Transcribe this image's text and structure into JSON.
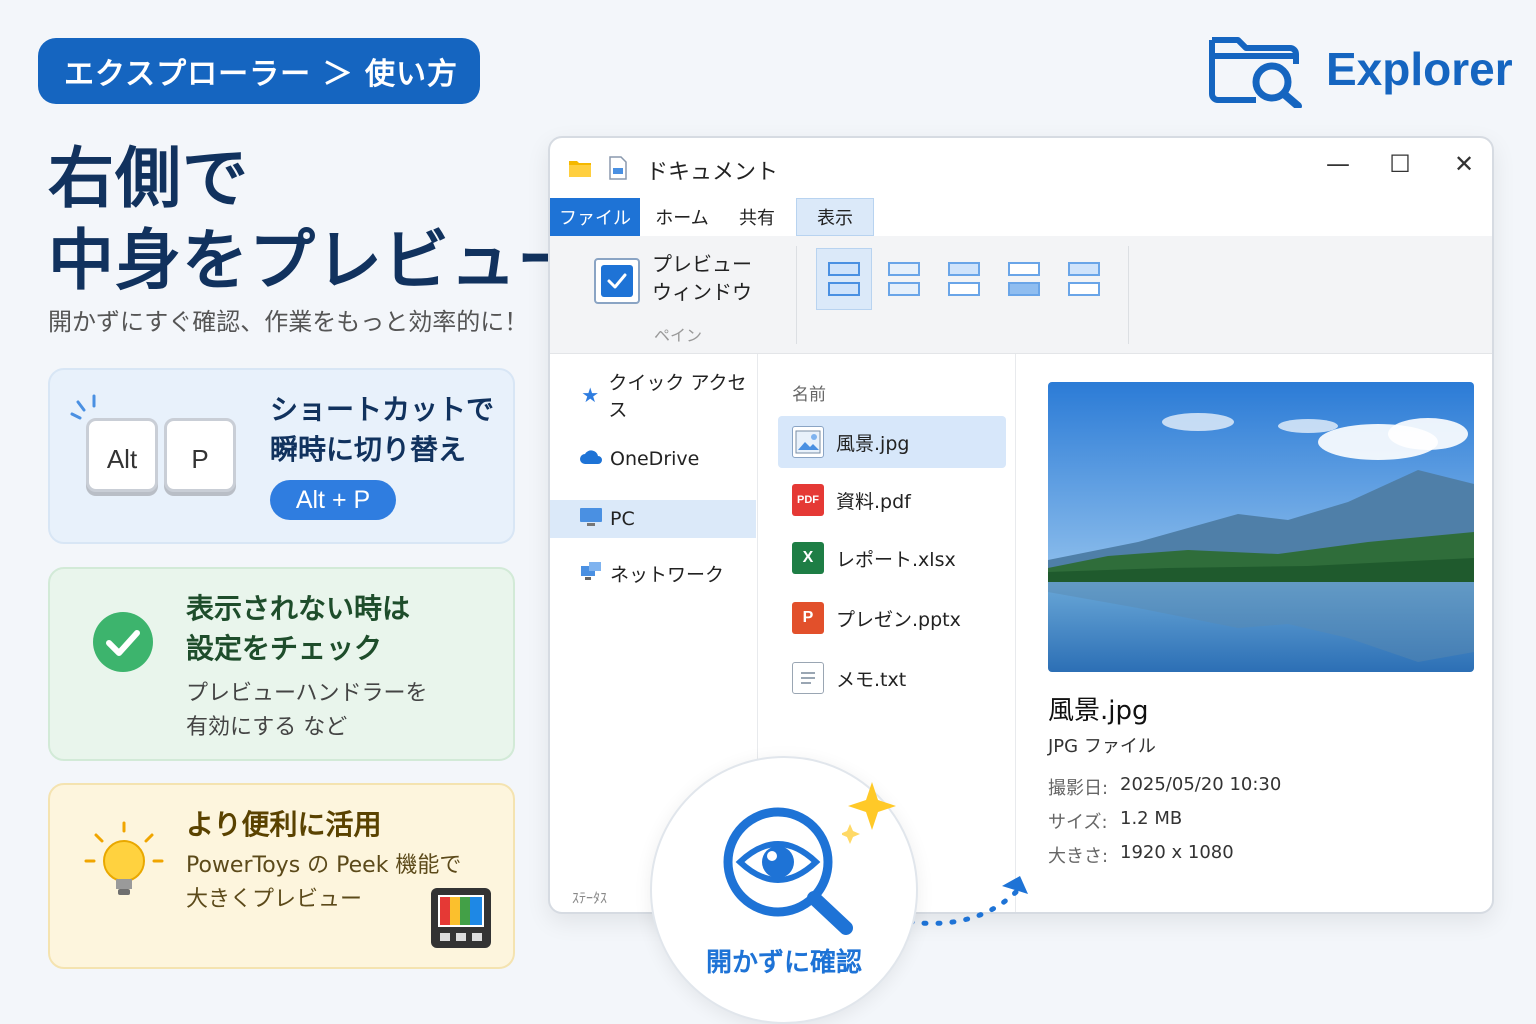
{
  "breadcrumb": "エクスプローラー ＞ 使い方",
  "brand": {
    "name": "Explorer",
    "accent": "#1565c0"
  },
  "headline": {
    "line1": "右側で",
    "line2": "中身をプレビュー"
  },
  "subhead": "開かずにすぐ確認、作業をもっと効率的に！",
  "cards": {
    "shortcut": {
      "key1": "Alt",
      "key2": "P",
      "title1": "ショートカットで",
      "title2": "瞬時に切り替え",
      "combo": "Alt + P"
    },
    "settings": {
      "title1": "表示されない時は",
      "title2": "設定をチェック",
      "body1": "プレビューハンドラーを",
      "body2": "有効にする など"
    },
    "tips": {
      "title": "より便利に活用",
      "body1": "PowerToys の Peek 機能で",
      "body2": "大きくプレビュー"
    }
  },
  "window": {
    "title": "ドキュメント",
    "controls": {
      "minimize": "—",
      "maximize": "☐",
      "close": "✕"
    },
    "menu": [
      "ファイル",
      "ホーム",
      "共有",
      "表示"
    ],
    "ribbon": {
      "preview_label1": "プレビュー",
      "preview_label2": "ウィンドウ",
      "pane_group": "ペイン",
      "preview_checked": true
    },
    "nav": [
      {
        "label": "クイック アクセス",
        "icon": "star-icon"
      },
      {
        "label": "OneDrive",
        "icon": "cloud-icon"
      },
      {
        "label": "PC",
        "icon": "monitor-icon"
      },
      {
        "label": "ネットワーク",
        "icon": "network-icon"
      }
    ],
    "nav_footer": "ｽﾃｰﾀｽ",
    "files_header": "名前",
    "files": [
      {
        "name": "風景.jpg",
        "icon": "image-file-icon",
        "selected": true
      },
      {
        "name": "資料.pdf",
        "icon": "pdf-file-icon",
        "badge": "PDF"
      },
      {
        "name": "レポート.xlsx",
        "icon": "excel-file-icon",
        "badge": "X"
      },
      {
        "name": "プレゼン.pptx",
        "icon": "powerpoint-file-icon",
        "badge": "P"
      },
      {
        "name": "メモ.txt",
        "icon": "text-file-icon"
      }
    ],
    "preview": {
      "filename": "風景.jpg",
      "filetype": "JPG ファイル",
      "meta": [
        {
          "label": "撮影日:",
          "value": "2025/05/20 10:30"
        },
        {
          "label": "サイズ:",
          "value": "1.2 MB"
        },
        {
          "label": "大きさ:",
          "value": "1920 x 1080"
        }
      ]
    }
  },
  "badge": {
    "label": "開かずに確認"
  }
}
